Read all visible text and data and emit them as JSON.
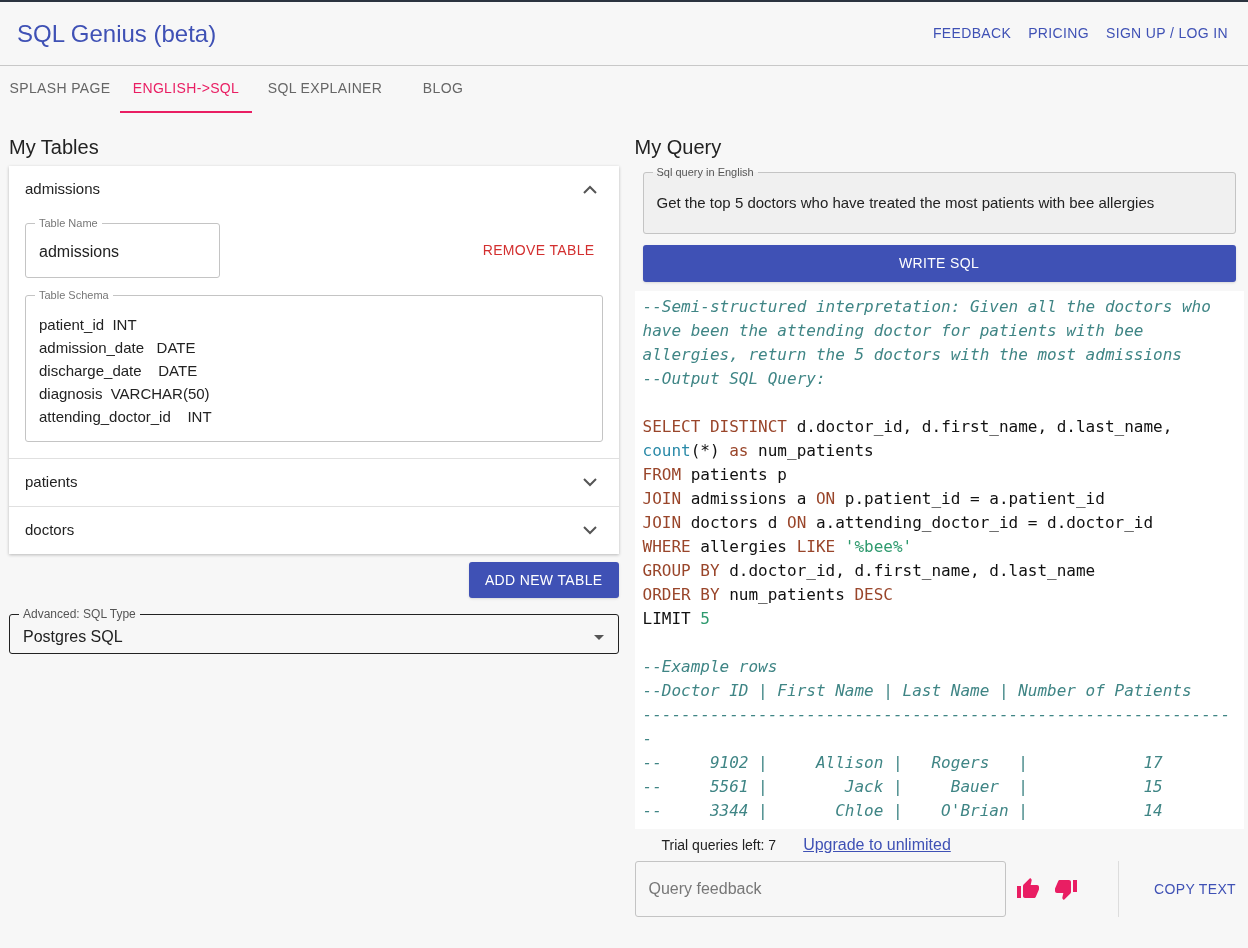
{
  "app_title": "SQL Genius (beta)",
  "nav_links": [
    "FEEDBACK",
    "PRICING",
    "SIGN UP / LOG IN"
  ],
  "tabs": [
    {
      "label": "SPLASH PAGE",
      "selected": false
    },
    {
      "label": "ENGLISH->SQL",
      "selected": true
    },
    {
      "label": "SQL EXPLAINER",
      "selected": false
    },
    {
      "label": "BLOG",
      "selected": false
    }
  ],
  "tables_panel": {
    "heading": "My Tables",
    "tables": [
      {
        "name": "admissions",
        "expanded": true,
        "table_name_label": "Table Name",
        "table_name": "admissions",
        "remove_button": "REMOVE TABLE",
        "schema_label": "Table Schema",
        "schema_lines": [
          "patient_id  INT",
          "admission_date   DATE",
          "discharge_date    DATE",
          "diagnosis  VARCHAR(50)",
          "attending_doctor_id    INT"
        ]
      },
      {
        "name": "patients",
        "expanded": false
      },
      {
        "name": "doctors",
        "expanded": false
      }
    ],
    "add_button": "ADD NEW TABLE",
    "sql_type": {
      "label": "Advanced: SQL Type",
      "value": "Postgres SQL"
    }
  },
  "query_panel": {
    "heading": "My Query",
    "query_label": "Sql query in English",
    "query_value": "Get the top 5 doctors who have treated the most patients with bee allergies",
    "write_button": "WRITE SQL",
    "code_lines": [
      [
        {
          "kind": "comment",
          "text": "--Semi-structured interpretation: Given all the doctors who"
        }
      ],
      [
        {
          "kind": "comment",
          "text": "have been the attending doctor for patients with bee"
        }
      ],
      [
        {
          "kind": "comment",
          "text": "allergies, return the 5 doctors with the most admissions"
        }
      ],
      [
        {
          "kind": "comment",
          "text": "--Output SQL Query:"
        }
      ],
      [
        {
          "kind": "gap"
        },
        {
          "kind": "keyword",
          "text": "SELECT DISTINCT"
        },
        {
          "kind": "plain",
          "text": " d.doctor_id, d.first_name, d.last_name,"
        }
      ],
      [
        {
          "kind": "function",
          "text": "count"
        },
        {
          "kind": "plain",
          "text": "(*) "
        },
        {
          "kind": "keyword",
          "text": "as"
        },
        {
          "kind": "plain",
          "text": " num_patients"
        }
      ],
      [
        {
          "kind": "keyword",
          "text": "FROM"
        },
        {
          "kind": "plain",
          "text": " patients p"
        }
      ],
      [
        {
          "kind": "keyword",
          "text": "JOIN"
        },
        {
          "kind": "plain",
          "text": " admissions a "
        },
        {
          "kind": "keyword",
          "text": "ON"
        },
        {
          "kind": "plain",
          "text": " p.patient_id = a.patient_id"
        }
      ],
      [
        {
          "kind": "keyword",
          "text": "JOIN"
        },
        {
          "kind": "plain",
          "text": " doctors d "
        },
        {
          "kind": "keyword",
          "text": "ON"
        },
        {
          "kind": "plain",
          "text": " a.attending_doctor_id = d.doctor_id"
        }
      ],
      [
        {
          "kind": "keyword",
          "text": "WHERE"
        },
        {
          "kind": "plain",
          "text": " allergies "
        },
        {
          "kind": "keyword",
          "text": "LIKE"
        },
        {
          "kind": "literal",
          "text": " '%bee%'"
        }
      ],
      [
        {
          "kind": "keyword",
          "text": "GROUP BY"
        },
        {
          "kind": "plain",
          "text": " d.doctor_id, d.first_name, d.last_name"
        }
      ],
      [
        {
          "kind": "keyword",
          "text": "ORDER BY"
        },
        {
          "kind": "plain",
          "text": " num_patients "
        },
        {
          "kind": "keyword",
          "text": "DESC"
        }
      ],
      [
        {
          "kind": "plain",
          "text": "LIMIT "
        },
        {
          "kind": "literal",
          "text": "5"
        }
      ],
      [
        {
          "kind": "gap"
        },
        {
          "kind": "comment",
          "text": "--Example rows"
        }
      ],
      [
        {
          "kind": "comment",
          "text": "--Doctor ID | First Name | Last Name | Number of Patients"
        }
      ],
      [
        {
          "kind": "comment",
          "text": "-------------------------------------------------------------"
        }
      ],
      [
        {
          "kind": "comment",
          "text": "-"
        }
      ],
      [
        {
          "kind": "comment",
          "text": "--     9102 |     Allison |   Rogers   |            17"
        }
      ],
      [
        {
          "kind": "comment",
          "text": "--     5561 |        Jack |     Bauer  |            15"
        }
      ],
      [
        {
          "kind": "comment",
          "text": "--     3344 |       Chloe |    O'Brian |            14"
        }
      ]
    ],
    "trial_text": "Trial queries left: 7",
    "upgrade_link": "Upgrade to unlimited",
    "feedback_placeholder": "Query feedback",
    "copy_button": "COPY TEXT"
  }
}
